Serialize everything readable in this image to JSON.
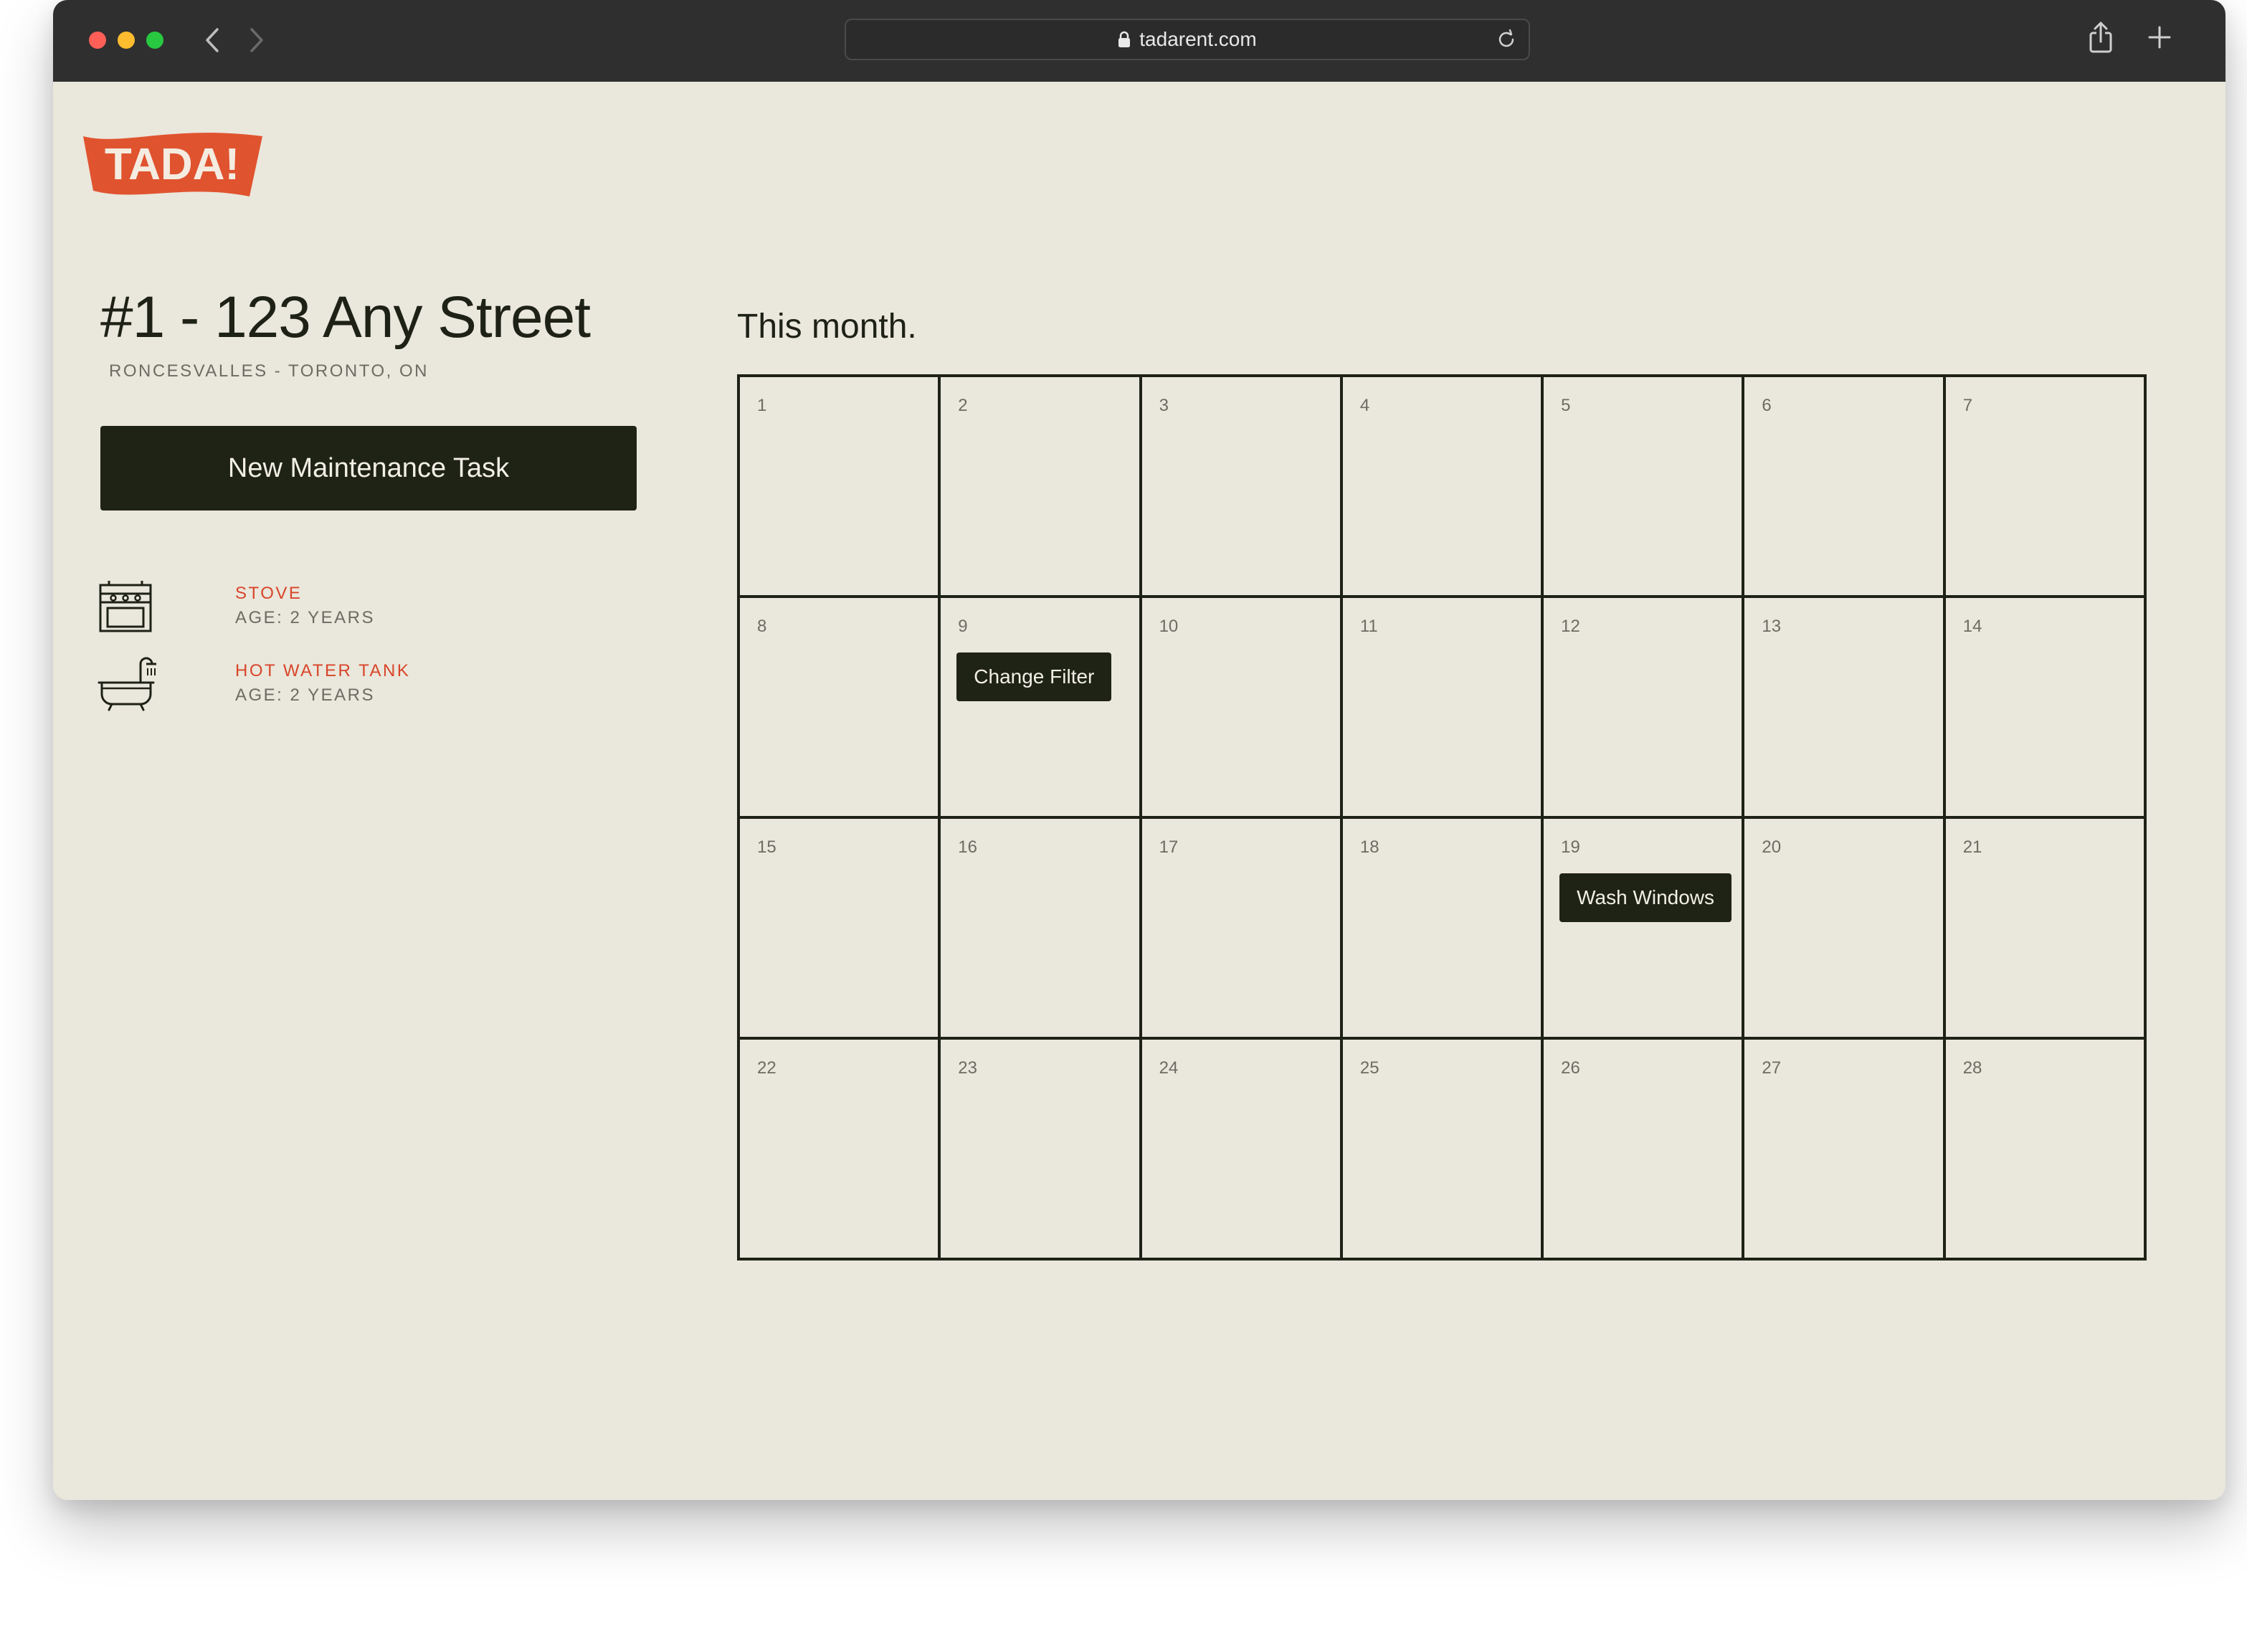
{
  "browser": {
    "url": "tadarent.com"
  },
  "brand": {
    "logo_text": "TADA!",
    "accent_color": "#e0532f"
  },
  "property": {
    "title": "#1 - 123 Any Street",
    "subtitle": "RONCESVALLES - TORONTO, ON"
  },
  "actions": {
    "new_task_label": "New Maintenance Task"
  },
  "appliances": [
    {
      "name": "STOVE",
      "age": "AGE: 2 YEARS",
      "icon": "stove-icon"
    },
    {
      "name": "HOT WATER TANK",
      "age": "AGE: 2 YEARS",
      "icon": "bathtub-icon"
    }
  ],
  "calendar": {
    "heading": "This month.",
    "days": [
      "1",
      "2",
      "3",
      "4",
      "5",
      "6",
      "7",
      "8",
      "9",
      "10",
      "11",
      "12",
      "13",
      "14",
      "15",
      "16",
      "17",
      "18",
      "19",
      "20",
      "21",
      "22",
      "23",
      "24",
      "25",
      "26",
      "27",
      "28"
    ],
    "tasks": [
      {
        "day": "9",
        "label": "Change Filter"
      },
      {
        "day": "19",
        "label": "Wash Windows"
      }
    ]
  },
  "colors": {
    "background": "#eae7dc",
    "dark": "#1f2315",
    "muted": "#6d6c63",
    "accent_text": "#d8462a"
  }
}
